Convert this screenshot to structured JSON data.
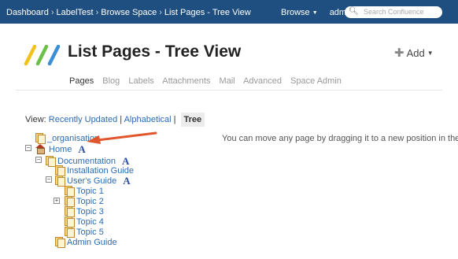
{
  "topbar": {
    "breadcrumbs": [
      "Dashboard",
      "LabelTest",
      "Browse Space",
      "List Pages - Tree View"
    ],
    "separator": "›",
    "browse_label": "Browse",
    "user_label": "admin",
    "search_placeholder": "Search Confluence"
  },
  "header": {
    "title": "List Pages - Tree View",
    "add_label": "Add"
  },
  "tabs": [
    "Pages",
    "Blog",
    "Labels",
    "Attachments",
    "Mail",
    "Advanced",
    "Space Admin"
  ],
  "active_tab": "Pages",
  "view": {
    "prefix": "View:",
    "recently_updated": "Recently Updated",
    "alphabetical": "Alphabetical",
    "sep": "|",
    "tree": "Tree"
  },
  "hint": "You can move any page by dragging it to a new position in the tree.",
  "tree": {
    "organisation": "_organisation",
    "home": "Home",
    "documentation": "Documentation",
    "installation_guide": "Installation Guide",
    "users_guide": "User's Guide",
    "topic1": "Topic 1",
    "topic2": "Topic 2",
    "topic3": "Topic 3",
    "topic4": "Topic 4",
    "topic5": "Topic 5",
    "admin_guide": "Admin Guide"
  },
  "icons": {
    "favourite": "A",
    "collapse": "−",
    "expand": "+"
  },
  "colors": {
    "topbar": "#1f4f80",
    "link": "#2b6bb3",
    "arrow": "#e0572e"
  }
}
